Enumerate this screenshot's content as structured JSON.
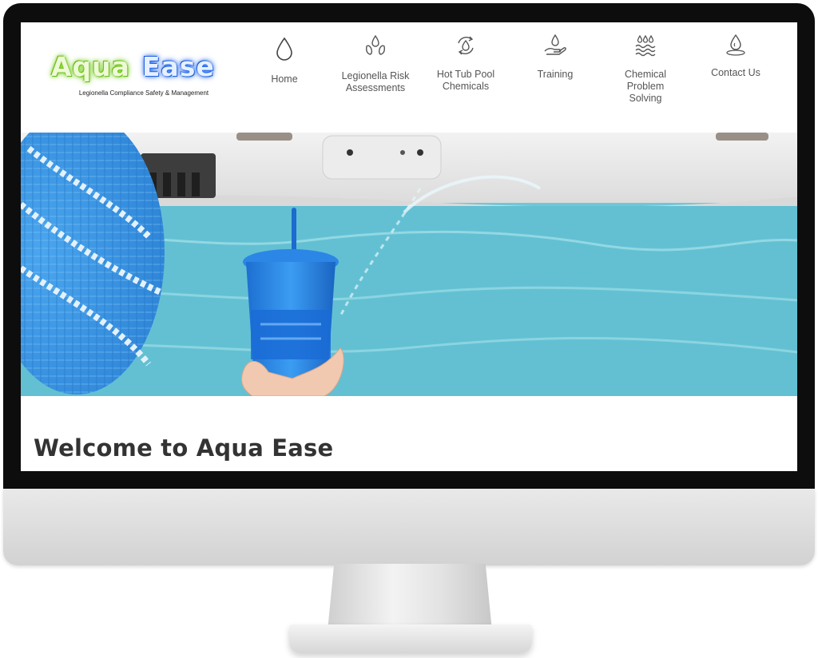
{
  "brand": {
    "name_part1": "Aqua",
    "name_part2": "Ease",
    "tagline": "Legionella Compliance Safety & Management"
  },
  "nav": {
    "items": [
      {
        "label": "Home",
        "icon": "water-drop-icon"
      },
      {
        "label": "Legionella Risk\nAssessments",
        "icon": "droplet-hands-icon"
      },
      {
        "label": "Hot Tub Pool\nChemicals",
        "icon": "recycle-drop-icon"
      },
      {
        "label": "Training",
        "icon": "hand-drop-icon"
      },
      {
        "label": "Chemical\nProblem\nSolving",
        "icon": "drops-waves-icon"
      },
      {
        "label": "Contact Us",
        "icon": "drop-ripple-icon"
      }
    ]
  },
  "hero": {
    "image": "hot-tub-with-blue-tumbler-photo"
  },
  "main": {
    "welcome_title": "Welcome to Aqua Ease"
  },
  "colors": {
    "logo_green": "#7ed321",
    "logo_blue": "#2f7bff",
    "nav_text": "#555555",
    "water": "#5bbad0"
  }
}
